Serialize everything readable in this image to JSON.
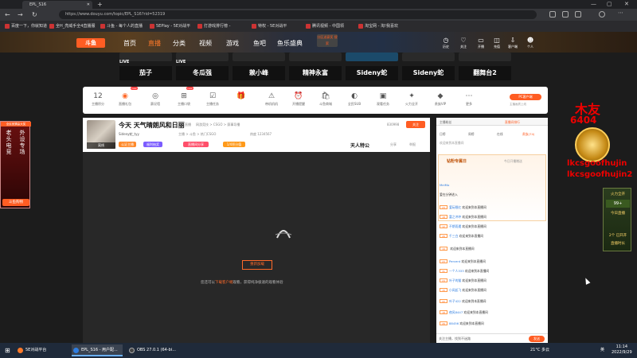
{
  "browser": {
    "tab_title": "EPL_S16",
    "new_tab": "+",
    "win_min": "—",
    "win_max": "▢",
    "win_close": "✕",
    "back": "←",
    "forward": "→",
    "reload": "↻",
    "url": "https://www.douyu.com/topic/EPL_S16?rid=52319",
    "bookmarks": [
      "百度一下，你就知道",
      "全H_亮威手全4直播服",
      "斗鱼 - 每个人的直播",
      "5EPlay - 5E对战平",
      "打游戏排行榜 -",
      "特权 - 5E对战平",
      "腾讯视频 - 中国领",
      "淘宝网 - 淘!我喜欢"
    ]
  },
  "site_header": {
    "logo": "斗鱼",
    "nav": [
      "首页",
      "直播",
      "分类",
      "视频",
      "游戏",
      "鱼吧",
      "鱼乐盛典"
    ],
    "active_nav": "直播",
    "search_btn": "分区送豪奖 搜索",
    "icons": [
      {
        "label": "历史",
        "icon": "clock-icon"
      },
      {
        "label": "关注",
        "icon": "heart-icon"
      },
      {
        "label": "开播",
        "icon": "broadcast-icon"
      },
      {
        "label": "充值",
        "icon": "wallet-icon"
      },
      {
        "label": "客户端",
        "icon": "download-icon"
      },
      {
        "label": "个人",
        "icon": "user-icon"
      }
    ]
  },
  "hot_anchors": [
    {
      "live": "LIVE",
      "name": "茄子"
    },
    {
      "live": "LIVE",
      "name": "冬瓜强"
    },
    {
      "live": "",
      "name": "赖小峰"
    },
    {
      "live": "",
      "name": "精神永富"
    },
    {
      "live": "",
      "name": "Sideny蛇"
    },
    {
      "live": "",
      "name": "Sideny蛇"
    },
    {
      "live": "",
      "name": "翻舞台2"
    }
  ],
  "categories": [
    {
      "label": "主播积分",
      "glyph": "12",
      "orange": false
    },
    {
      "label": "直播礼包",
      "glyph": "◉",
      "orange": true
    },
    {
      "label": "赛况墙",
      "glyph": "◎",
      "orange": false
    },
    {
      "label": "主播口袋",
      "glyph": "⊞",
      "orange": false
    },
    {
      "label": "主播任务",
      "glyph": "☑",
      "orange": false
    },
    {
      "label": "",
      "glyph": "🎁",
      "orange": false
    },
    {
      "label": "带机机机",
      "glyph": "⚠",
      "orange": false
    },
    {
      "label": "开播提醒",
      "glyph": "⏰",
      "orange": false
    },
    {
      "label": "斗鱼商城",
      "glyph": "🛍",
      "orange": false
    },
    {
      "label": "全民SUB",
      "glyph": "◐",
      "orange": false
    },
    {
      "label": "观看任务",
      "glyph": "▣",
      "orange": false
    },
    {
      "label": "火力全开",
      "glyph": "✦",
      "orange": false
    },
    {
      "label": "贵族VIP",
      "glyph": "◆",
      "orange": false
    },
    {
      "label": "更多",
      "glyph": "⋯",
      "orange": false
    }
  ],
  "category_badge": "new",
  "pc_button": "PC客户端",
  "pc_sub": "主播画质上线",
  "room": {
    "avatar_label": "离线",
    "title": "今天 天气晴朗风和日丽",
    "tag1": "直播",
    "category": "网游竞技 > CSGO > 赛事导播",
    "pills": [
      "认证主播",
      "福利抽奖",
      "直播间分享",
      "1/4积分值"
    ],
    "pill_colors": [
      "#ff8a2a",
      "#7b5cff",
      "#ff4f6a",
      "#ff9a1a"
    ],
    "meta1": "Sideny蛇_tyy",
    "meta2": "主播 > 斗鱼 > 热门CSGO",
    "meta3": "热度 1234567",
    "fans": "830998",
    "follow": "关注",
    "brand": "天人特公",
    "share": "分享",
    "report": "举报"
  },
  "player": {
    "refresh_btn": "重新加载",
    "tip_prefix": "您还可以",
    "tip_link": "下载客户端",
    "tip_suffix": "观看，获得纯净极速的观看体验"
  },
  "chat": {
    "rank_tabs": [
      "主播粉丝",
      "直播间排行"
    ],
    "tabs": [
      "日榜",
      "周榜",
      "在线",
      "贵族(74)"
    ],
    "active_tab": "贵族(74)",
    "notice": "欢迎来到本直播间",
    "banner_title": "钻粉专属日",
    "banner_sub": "今日开播赠送",
    "messages": [
      {
        "lv": "20",
        "user": "MeiMo",
        "text": ""
      },
      {
        "lv": "27",
        "user": "",
        "text": "爱在分钟进入"
      },
      {
        "lv": "23",
        "user": "爱玩眼红",
        "text": "欢迎来到本直播间"
      },
      {
        "lv": "18",
        "user": "富之冲冲",
        "text": "欢迎来到本直播间"
      },
      {
        "lv": "12",
        "user": "不期而遇",
        "text": "欢迎来到本直播间"
      },
      {
        "lv": "26",
        "user": "千三白",
        "text": "欢迎来到本直播间"
      },
      {
        "lv": "19",
        "user": "",
        "text": "欢迎来到本直播间"
      },
      {
        "lv": "23",
        "user": "Percent",
        "text": "欢迎来到本直播间"
      },
      {
        "lv": "31",
        "user": "一个人333",
        "text": "欢迎来到本直播间"
      },
      {
        "lv": "24",
        "user": "叶子的猫",
        "text": "欢迎来到本直播间"
      },
      {
        "lv": "15",
        "user": "小风起飞",
        "text": "欢迎来到本直播间"
      },
      {
        "lv": "22",
        "user": "叶子422",
        "text": "欢迎来到本直播间"
      },
      {
        "lv": "18",
        "user": "夜风8447",
        "text": "欢迎来到本直播间"
      },
      {
        "lv": "26",
        "user": "88456",
        "text": "欢迎来到本直播间"
      }
    ],
    "input_placeholder": "关注主播，找到不迷路",
    "send": "发送"
  },
  "left_promo": {
    "top": "全民竞猜赢大奖",
    "col1": "老头电竞",
    "col2": "外设专场",
    "btn": "斗鱼购物"
  },
  "overlay": {
    "line1": "木友",
    "line2": "6404",
    "line3": "lkcsgoofhujin",
    "line4": "lkcsgoofhujin2"
  },
  "right_promo": {
    "t1": "火力全开",
    "num": "99+",
    "t2": "今日直播",
    "t3": "2个 已开开",
    "t4": "直播时长"
  },
  "taskbar": {
    "start": "⊞",
    "tasks": [
      {
        "label": "5E对战平台",
        "color": "#ff7a2a"
      },
      {
        "label": "EPL_S16 - 用户配...",
        "color": "#2f7de0"
      },
      {
        "label": "OBS 27.0.1 (64-bi...",
        "color": "#444"
      }
    ],
    "temp": "21°C 多云",
    "lang": "英",
    "time": "11:14",
    "date": "2022/9/29"
  }
}
